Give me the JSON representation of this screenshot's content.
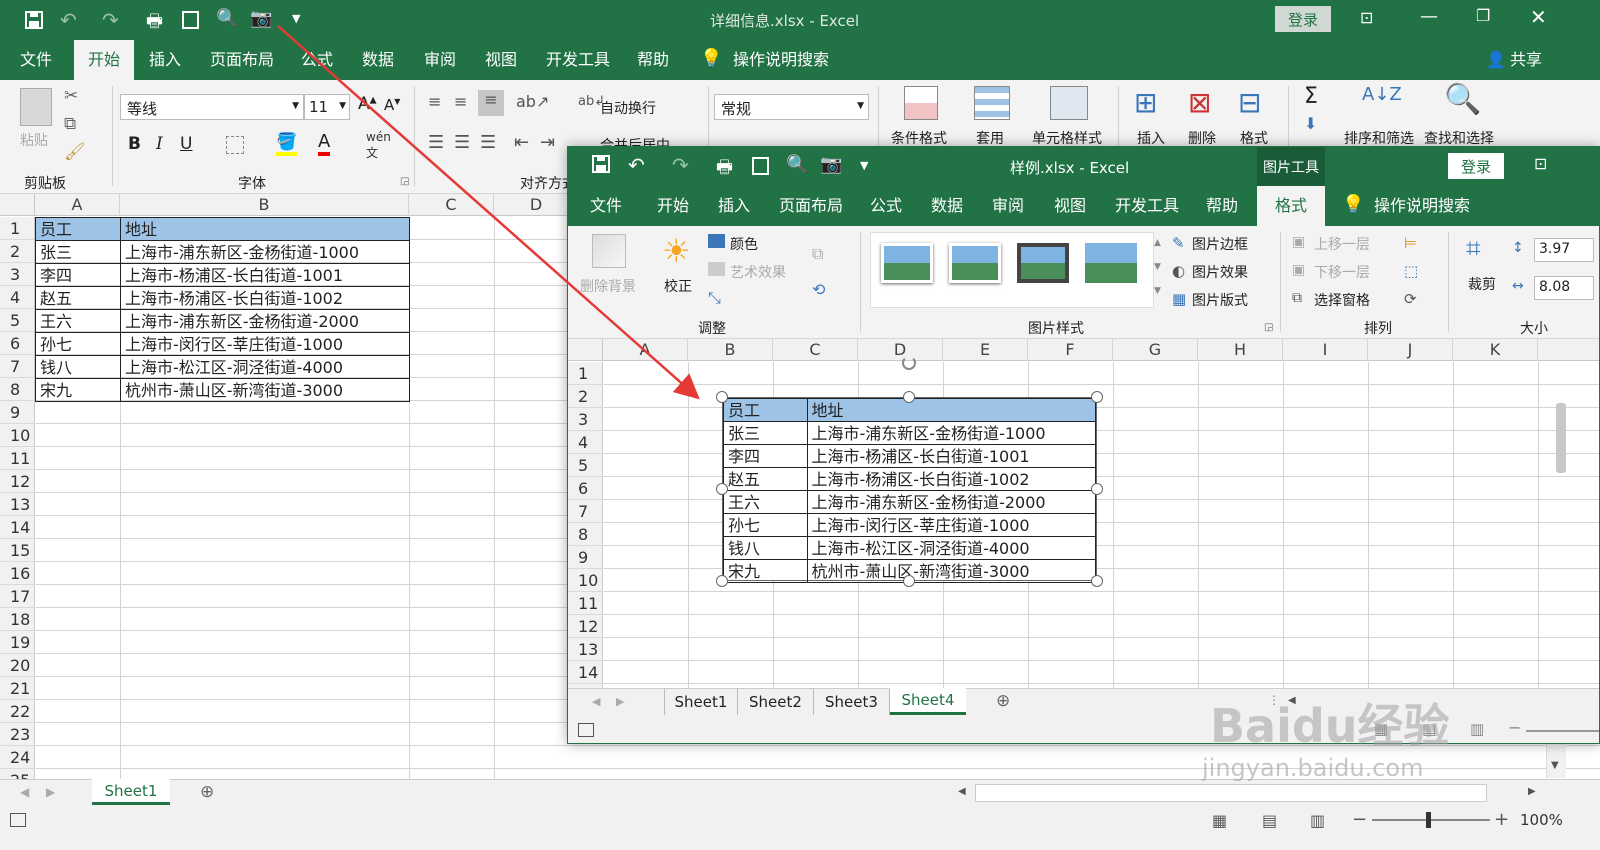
{
  "back_window": {
    "title": "详细信息.xlsx  -  Excel",
    "login_label": "登录",
    "share_label": "共享",
    "tabs": [
      "文件",
      "开始",
      "插入",
      "页面布局",
      "公式",
      "数据",
      "审阅",
      "视图",
      "开发工具",
      "帮助"
    ],
    "search_label": "操作说明搜索",
    "ribbon": {
      "paste_label": "粘贴",
      "clipboard_label": "剪贴板",
      "font_name": "等线",
      "font_size": "11",
      "font_group_label": "字体",
      "wrap_label": "自动换行",
      "merge_label": "合并后居中",
      "align_group_label": "对齐方式",
      "number_format": "常规",
      "cond_format_label": "条件格式",
      "table_format_label": "套用",
      "cell_style_label": "单元格样式",
      "insert_label": "插入",
      "delete_label": "删除",
      "format_label": "格式",
      "sort_label": "排序和筛选",
      "find_label": "查找和选择"
    },
    "columns": [
      "A",
      "B",
      "C",
      "D"
    ],
    "rows": [
      "1",
      "2",
      "3",
      "4",
      "5",
      "6",
      "7",
      "8",
      "9",
      "10",
      "11",
      "12",
      "13",
      "14",
      "15",
      "16",
      "17",
      "18",
      "19",
      "20",
      "21",
      "22",
      "23",
      "24",
      "25"
    ],
    "table": [
      [
        "员工",
        "地址"
      ],
      [
        "张三",
        "上海市-浦东新区-金杨街道-1000"
      ],
      [
        "李四",
        "上海市-杨浦区-长白街道-1001"
      ],
      [
        "赵五",
        "上海市-杨浦区-长白街道-1002"
      ],
      [
        "王六",
        "上海市-浦东新区-金杨街道-2000"
      ],
      [
        "孙七",
        "上海市-闵行区-莘庄街道-1000"
      ],
      [
        "钱八",
        "上海市-松江区-洞泾街道-4000"
      ],
      [
        "宋九",
        "杭州市-萧山区-新湾街道-3000"
      ]
    ],
    "sheet_tab": "Sheet1",
    "zoom": "100%"
  },
  "front_window": {
    "title": "样例.xlsx  -  Excel",
    "context_tab": "图片工具",
    "login_label": "登录",
    "tabs": [
      "文件",
      "开始",
      "插入",
      "页面布局",
      "公式",
      "数据",
      "审阅",
      "视图",
      "开发工具",
      "帮助",
      "格式"
    ],
    "search_label": "操作说明搜索",
    "ribbon": {
      "remove_bg_label": "删除背景",
      "correct_label": "校正",
      "color_label": "颜色",
      "artistic_label": "艺术效果",
      "adjust_group_label": "调整",
      "border_label": "图片边框",
      "effect_label": "图片效果",
      "layout_label": "图片版式",
      "styles_group_label": "图片样式",
      "bring_forward_label": "上移一层",
      "send_backward_label": "下移一层",
      "selection_pane_label": "选择窗格",
      "arrange_group_label": "排列",
      "crop_label": "裁剪",
      "height_value": "3.97",
      "width_value": "8.08",
      "size_group_label": "大小"
    },
    "columns": [
      "A",
      "B",
      "C",
      "D",
      "E",
      "F",
      "G",
      "H",
      "I",
      "J",
      "K"
    ],
    "rows": [
      "1",
      "2",
      "3",
      "4",
      "5",
      "6",
      "7",
      "8",
      "9",
      "10",
      "11",
      "12",
      "13",
      "14"
    ],
    "sheet_tabs": [
      "Sheet1",
      "Sheet2",
      "Sheet3",
      "Sheet4"
    ],
    "active_sheet": "Sheet4"
  },
  "watermark": {
    "brand": "Baidu经验",
    "url": "jingyan.baidu.com"
  },
  "colors": {
    "excel_green": "#217346",
    "header_fill": "#9dc3e6",
    "arrow": "#e53935"
  }
}
